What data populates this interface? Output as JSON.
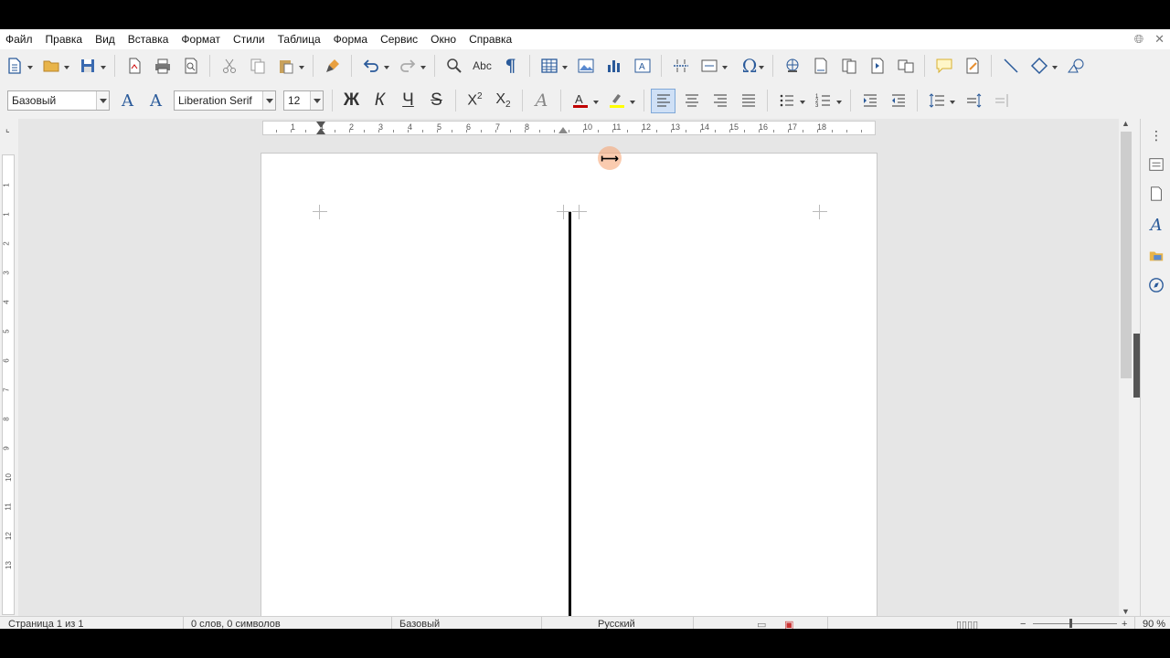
{
  "menu": [
    "Файл",
    "Правка",
    "Вид",
    "Вставка",
    "Формат",
    "Стили",
    "Таблица",
    "Форма",
    "Сервис",
    "Окно",
    "Справка"
  ],
  "formatting": {
    "paragraph_style": "Базовый",
    "font_name": "Liberation Serif",
    "font_size": "12",
    "bold_label": "Ж",
    "italic_label": "К",
    "underline_label": "Ч",
    "strike_label": "S"
  },
  "ruler": {
    "numbers": [
      "1",
      "1",
      "2",
      "3",
      "4",
      "5",
      "6",
      "7",
      "8",
      "10",
      "11",
      "12",
      "13",
      "14",
      "15",
      "16",
      "17",
      "18"
    ]
  },
  "vruler": {
    "numbers": [
      "1",
      "1",
      "2",
      "3",
      "4",
      "5",
      "6",
      "7",
      "8",
      "9",
      "10",
      "11",
      "12",
      "13"
    ]
  },
  "statusbar": {
    "page": "Страница 1 из 1",
    "words": "0 слов, 0 символов",
    "style": "Базовый",
    "language": "Русский",
    "zoom": "90 %"
  },
  "colors": {
    "font_color": "#c00000",
    "highlight_color": "#ffff00",
    "accent": "#7fa8d8"
  }
}
